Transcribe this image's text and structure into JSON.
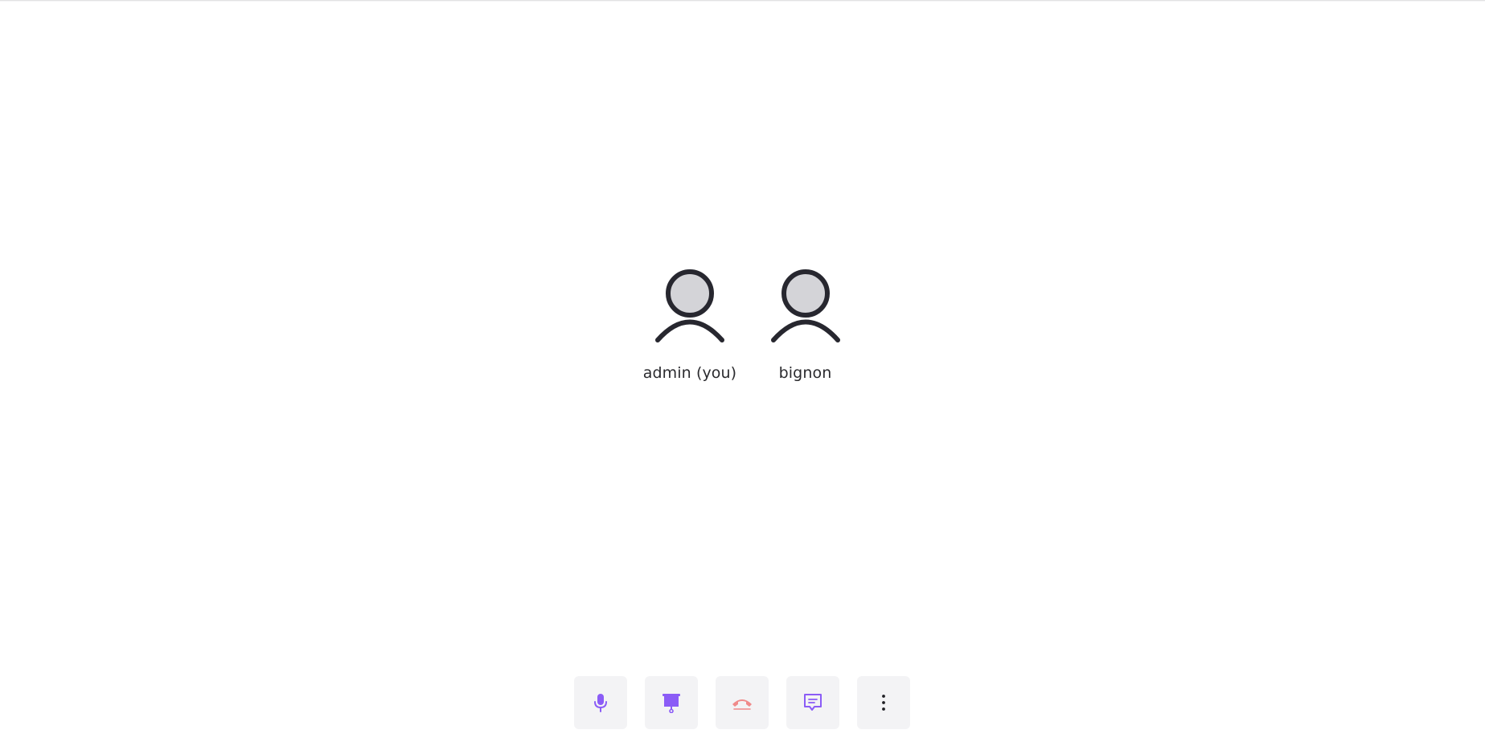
{
  "participants": [
    {
      "name": "admin (you)",
      "avatar_icon": "user-icon"
    },
    {
      "name": "bignon",
      "avatar_icon": "user-icon"
    }
  ],
  "toolbar": {
    "buttons": [
      {
        "id": "microphone",
        "icon": "microphone-icon",
        "color": "#8b5cf6"
      },
      {
        "id": "presentation",
        "icon": "presentation-icon",
        "color": "#8b5cf6"
      },
      {
        "id": "hang-up",
        "icon": "phone-hangup-icon",
        "color": "#f08a8a"
      },
      {
        "id": "chat",
        "icon": "chat-icon",
        "color": "#8b5cf6"
      },
      {
        "id": "more",
        "icon": "more-vertical-icon",
        "color": "#1f1f24"
      }
    ]
  },
  "colors": {
    "accent": "#8b5cf6",
    "danger": "#f08a8a",
    "avatar_fill": "#d4d4d8",
    "avatar_stroke": "#27272f",
    "button_bg": "#f3f3f5"
  }
}
